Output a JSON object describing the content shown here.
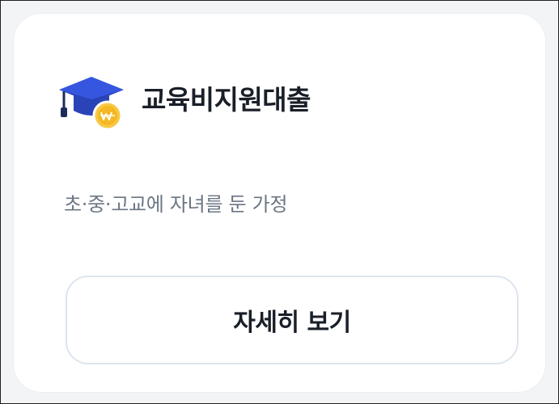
{
  "card": {
    "icon": "graduation-cap-with-won-coin-icon",
    "title": "교육비지원대출",
    "subtitle": "초·중·고교에 자녀를 둔 가정",
    "button_label": "자세히 보기"
  },
  "colors": {
    "page_background": "#f2f4f6",
    "card_background": "#ffffff",
    "title_text": "#191f28",
    "subtitle_text": "#6b7684",
    "button_border": "#dde5ee",
    "cap_blue": "#2f4fd6",
    "coin_yellow": "#f7c948"
  }
}
